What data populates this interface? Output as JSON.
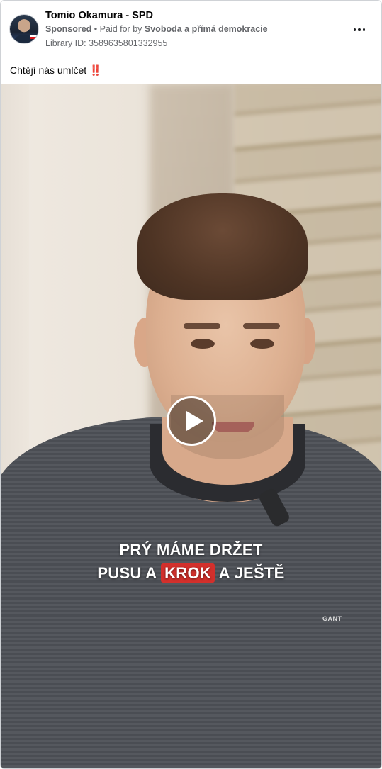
{
  "post": {
    "page_name": "Tomio Okamura - SPD",
    "sponsored_label": "Sponsored",
    "paid_for_prefix": "Paid for by",
    "payer": "Svoboda a přímá demokracie",
    "library_id": "Library ID: 3589635801332955",
    "caption_text": "Chtějí nás umlčet",
    "caption_emoji": "‼️",
    "more_icon": "more-horizontal-icon"
  },
  "video": {
    "play_icon": "play-icon",
    "subtitle_line1": "PRÝ MÁME DRŽET",
    "subtitle_line2_pre": "PUSU A",
    "subtitle_line2_highlight": "KROK",
    "subtitle_line2_post": "A JEŠTĚ",
    "shirt_logo": "GANT",
    "highlight_color": "#d3302c"
  }
}
